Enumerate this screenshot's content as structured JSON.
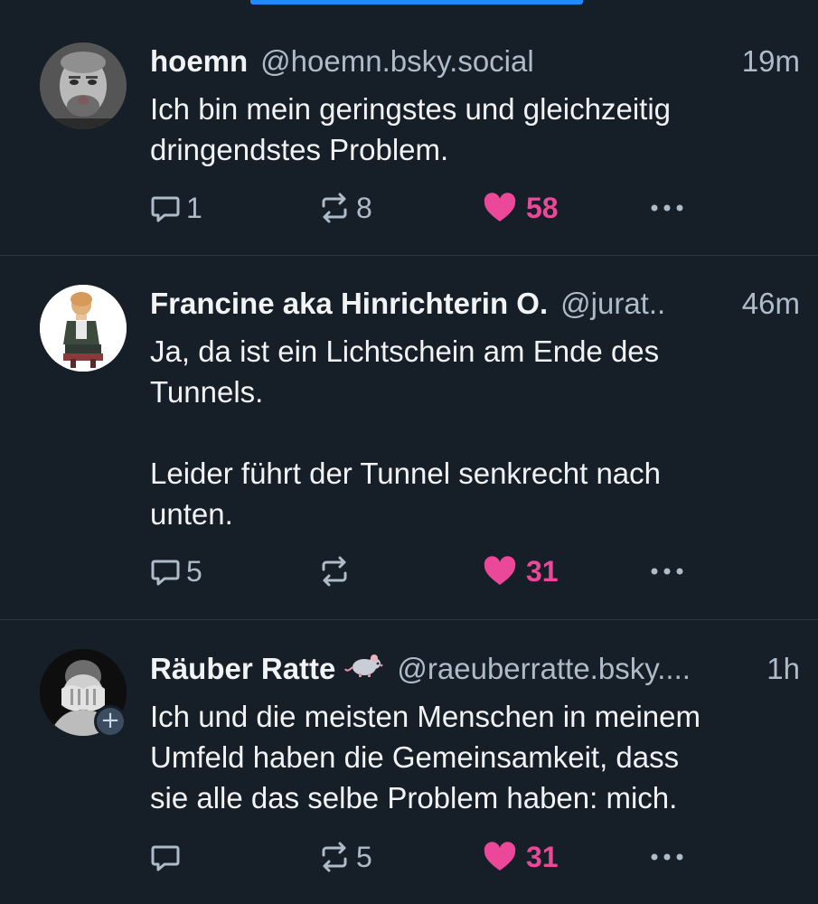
{
  "colors": {
    "background": "#161e27",
    "text": "#f1f3f5",
    "muted": "#aebbc9",
    "like": "#ec4899",
    "accent": "#208bfe",
    "divider": "#2a3441"
  },
  "posts": [
    {
      "name": "hoemn",
      "handle": "@hoemn.bsky.social",
      "time": "19m",
      "text": "Ich bin mein geringstes und gleichzeitig\ndringendstes Problem.",
      "replies": "1",
      "reposts": "8",
      "likes": "58",
      "liked": true,
      "avatar_icon": "avatar-photo-man"
    },
    {
      "name": "Francine aka Hinrichterin O.",
      "handle": "@jurat..",
      "time": "46m",
      "text": "Ja, da ist ein Lichtschein am Ende des\nTunnels.\n\nLeider führt der Tunnel senkrecht nach\nunten.",
      "replies": "5",
      "reposts": "",
      "likes": "31",
      "liked": true,
      "avatar_icon": "avatar-illustration-woman"
    },
    {
      "name": "Räuber Ratte",
      "name_emoji": "rat-emoji",
      "handle": "@raeuberratte.bsky....",
      "time": "1h",
      "text": "Ich und die meisten Menschen in meinem\nUmfeld haben die Gemeinsamkeit, dass\nsie alle das selbe Problem haben: mich.",
      "replies": "",
      "reposts": "5",
      "likes": "31",
      "liked": true,
      "avatar_icon": "avatar-photo-hands-face",
      "follow_badge": "+"
    }
  ]
}
